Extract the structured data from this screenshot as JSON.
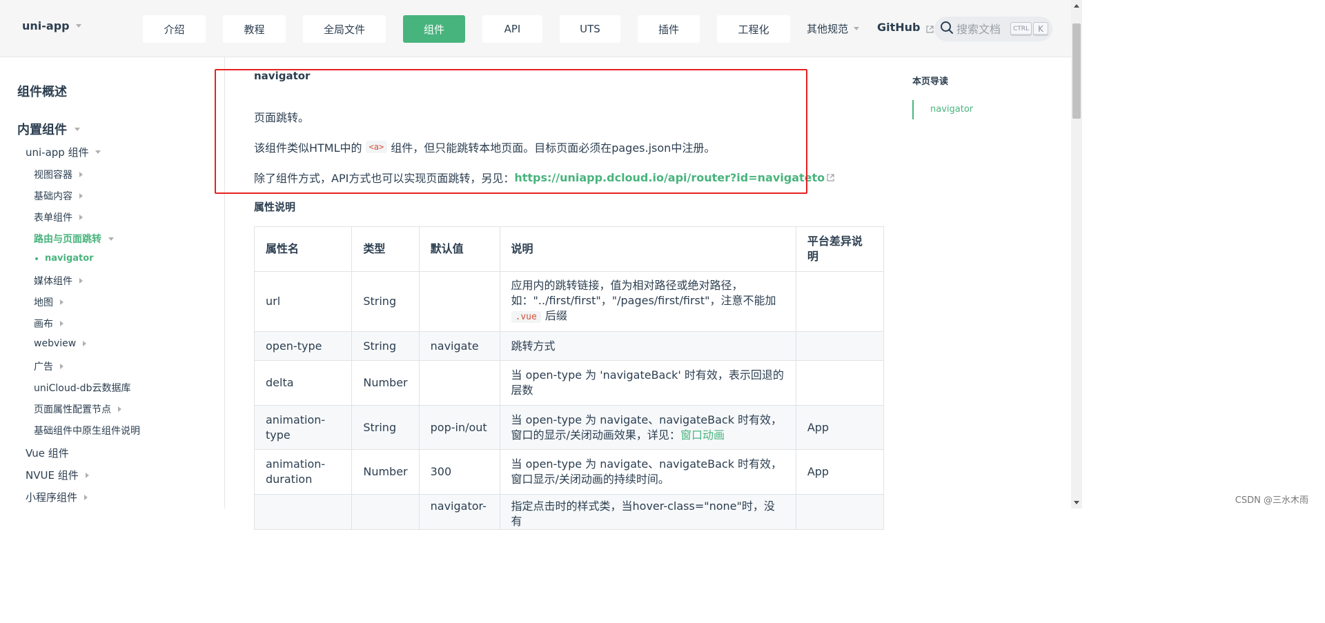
{
  "header": {
    "brand": "uni-app",
    "nav": [
      {
        "label": "介绍"
      },
      {
        "label": "教程"
      },
      {
        "label": "全局文件"
      },
      {
        "label": "组件",
        "active": true
      },
      {
        "label": "API"
      },
      {
        "label": "UTS"
      },
      {
        "label": "插件"
      },
      {
        "label": "工程化"
      }
    ],
    "more_label": "其他规范",
    "github_label": "GitHub",
    "search_placeholder": "搜索文档",
    "key_ctrl": "CTRL",
    "key_k": "K"
  },
  "sidebar": {
    "overview": "组件概述",
    "builtin": "内置组件",
    "uniapp_components": "uni-app 组件",
    "items": [
      "视图容器",
      "基础内容",
      "表单组件",
      "路由与页面跳转",
      "navigator",
      "媒体组件",
      "地图",
      "画布",
      "webview",
      "广告",
      "uniCloud-db云数据库",
      "页面属性配置节点",
      "基础组件中原生组件说明"
    ],
    "vue_components": "Vue 组件",
    "nvue_components": "NVUE 组件",
    "mp_components": "小程序组件"
  },
  "content": {
    "heading": "navigator",
    "p1": "页面跳转。",
    "p2_before": "该组件类似HTML中的",
    "p2_code": "<a>",
    "p2_after": "组件，但只能跳转本地页面。目标页面必须在pages.json中注册。",
    "p3_before": "除了组件方式，API方式也可以实现页面跳转，另见：",
    "p3_link": "https://uniapp.dcloud.io/api/router?id=navigateto",
    "section_title": "属性说明",
    "table": {
      "headers": [
        "属性名",
        "类型",
        "默认值",
        "说明",
        "平台差异说明"
      ],
      "rows": [
        {
          "name": "url",
          "type": "String",
          "default": "",
          "desc_a": "应用内的跳转链接，值为相对路径或绝对路径，如：\"../first/first\"，\"/pages/first/first\"，注意不能加",
          "desc_code": ".vue",
          "desc_b": "后缀",
          "platform": ""
        },
        {
          "name": "open-type",
          "type": "String",
          "default": "navigate",
          "desc_a": "跳转方式",
          "platform": ""
        },
        {
          "name": "delta",
          "type": "Number",
          "default": "",
          "desc_a": "当 open-type 为 'navigateBack' 时有效，表示回退的层数",
          "platform": ""
        },
        {
          "name": "animation-type",
          "type": "String",
          "default": "pop-in/out",
          "desc_a": "当 open-type 为 navigate、navigateBack 时有效，窗口的显示/关闭动画效果，详见：",
          "desc_link": "窗口动画",
          "platform": "App"
        },
        {
          "name": "animation-duration",
          "type": "Number",
          "default": "300",
          "desc_a": "当 open-type 为 navigate、navigateBack 时有效，窗口显示/关闭动画的持续时间。",
          "platform": "App"
        },
        {
          "name": "",
          "type": "",
          "default": "navigator-",
          "desc_a": "指定点击时的样式类，当hover-class=\"none\"时，没有",
          "platform": ""
        }
      ]
    }
  },
  "toc": {
    "title": "本页导读",
    "items": [
      "navigator"
    ]
  },
  "watermark": "CSDN @三水木雨",
  "colors": {
    "accent": "#48b47d",
    "highlight_box": "#e62020"
  }
}
